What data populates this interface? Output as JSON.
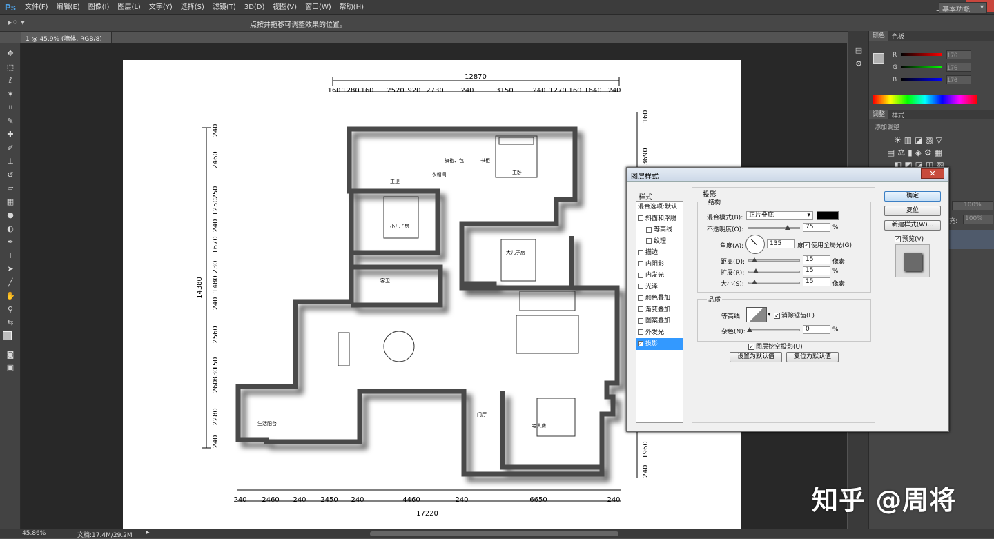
{
  "app": {
    "logo": "Ps"
  },
  "menu": [
    "文件(F)",
    "编辑(E)",
    "图像(I)",
    "图层(L)",
    "文字(Y)",
    "选择(S)",
    "滤镜(T)",
    "3D(D)",
    "视图(V)",
    "窗口(W)",
    "帮助(H)"
  ],
  "options": {
    "hint": "点按并拖移可调整效果的位置。",
    "workspace": "基本功能"
  },
  "document": {
    "tab": "1 @ 45.9% (墙体, RGB/8) *"
  },
  "status": {
    "zoom": "45.86%",
    "doc": "文档:17.4M/29.2M"
  },
  "panels": {
    "color_tab": "颜色",
    "swatches_tab": "色板",
    "channels": [
      {
        "name": "R",
        "value": "176"
      },
      {
        "name": "G",
        "value": "176"
      },
      {
        "name": "B",
        "value": "176"
      }
    ],
    "adjust_tab": "调整",
    "styles_tab": "样式",
    "adjust_title": "添加调整",
    "opacity_value": "100%",
    "fill_value": "100%",
    "fill_label": "充:"
  },
  "dialog": {
    "title": "图层样式",
    "styles_header": "样式",
    "list": [
      {
        "label": "混合选项:默认",
        "check": false,
        "head": true
      },
      {
        "label": "斜面和浮雕",
        "check": true
      },
      {
        "label": "等高线",
        "check": true,
        "indent": true
      },
      {
        "label": "纹理",
        "check": true,
        "indent": true
      },
      {
        "label": "描边",
        "check": true
      },
      {
        "label": "内阴影",
        "check": true
      },
      {
        "label": "内发光",
        "check": true
      },
      {
        "label": "光泽",
        "check": true
      },
      {
        "label": "颜色叠加",
        "check": true
      },
      {
        "label": "渐变叠加",
        "check": true
      },
      {
        "label": "图案叠加",
        "check": true
      },
      {
        "label": "外发光",
        "check": true
      },
      {
        "label": "投影",
        "check": true,
        "checked": true,
        "selected": true
      }
    ],
    "section": "投影",
    "structure": "结构",
    "blend_label": "混合模式(B):",
    "blend_value": "正片叠底",
    "opacity_label": "不透明度(O):",
    "opacity_value": "75",
    "percent": "%",
    "angle_label": "角度(A):",
    "angle_value": "135",
    "degree": "度",
    "global_light": "使用全局光(G)",
    "distance_label": "距离(D):",
    "distance_value": "15",
    "px": "像素",
    "spread_label": "扩展(R):",
    "spread_value": "15",
    "size_label": "大小(S):",
    "size_value": "15",
    "quality": "品质",
    "contour_label": "等高线:",
    "antialias": "消除锯齿(L)",
    "noise_label": "杂色(N):",
    "noise_value": "0",
    "knockout": "图层挖空投影(U)",
    "set_default": "设置为默认值",
    "reset_default": "复位为默认值",
    "ok": "确定",
    "reset": "复位",
    "new_style": "新建样式(W)...",
    "preview": "预览(V)"
  },
  "plan": {
    "top_total": "12870",
    "top_dims": [
      "160",
      "1280",
      "160",
      "2520",
      "920",
      "2730",
      "240",
      "3150",
      "240",
      "1270",
      "160",
      "1640",
      "240"
    ],
    "left_total": "14380",
    "left_dims": [
      "240",
      "2460",
      "250",
      "1250",
      "240",
      "1670",
      "230",
      "1480",
      "240",
      "2560",
      "150",
      "830",
      "260",
      "2280",
      "240"
    ],
    "right_dims": [
      "160",
      "3690",
      "1960",
      "240"
    ],
    "bottom_total": "17220",
    "bottom_dims": [
      "240",
      "2460",
      "240",
      "2450",
      "240",
      "4460",
      "240",
      "6650",
      "240"
    ],
    "rooms": [
      "主卫",
      "衣帽间",
      "主卧",
      "小儿子房",
      "大儿子房",
      "客卫",
      "生活阳台",
      "门厅",
      "老人房",
      "旗袍、包",
      "书柜"
    ]
  },
  "watermark": "知乎 @周将"
}
